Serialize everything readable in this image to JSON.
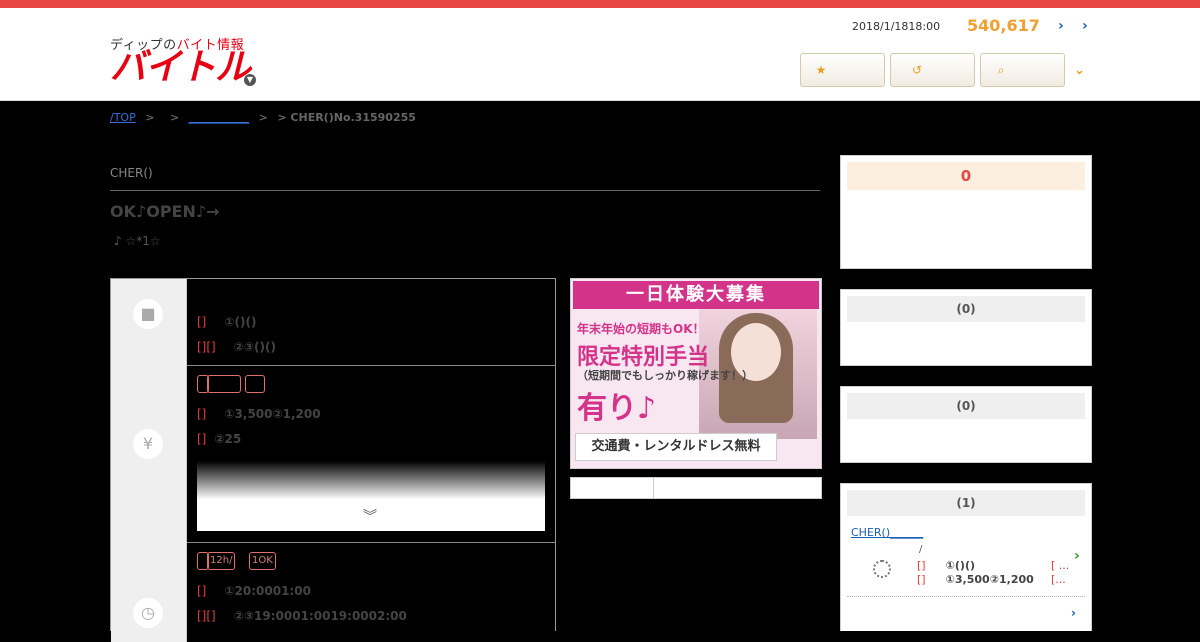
{
  "header": {
    "logo_sub_a": "ディップの",
    "logo_sub_b": "バイト情報",
    "logo_main": "バイトル",
    "date": "2018/1/1818:00",
    "count": "540,617",
    "link1": "›",
    "link2": "›",
    "buttons": [
      {
        "label": "",
        "icon": "star-icon"
      },
      {
        "label": "",
        "icon": "history-icon"
      },
      {
        "label": "",
        "icon": "search-icon"
      }
    ],
    "more": "⌄"
  },
  "breadcrumb": {
    "top": "/TOP",
    "sep": ">",
    "link2": "___________",
    "current": "> CHER()No.31590255"
  },
  "job": {
    "shop": "CHER()",
    "title": "OK♪OPEN♪→",
    "catch": "♪ ☆*1☆"
  },
  "table": {
    "row1": {
      "icon": "briefcase-icon",
      "lines": [
        {
          "tag": "[]",
          "value": "①()()"
        },
        {
          "tag": "[][]",
          "value": "②③()()"
        }
      ]
    },
    "row2": {
      "icon": "yen-icon",
      "badges": [
        "",
        "",
        ""
      ],
      "lines": [
        {
          "tag": "[]",
          "value": "①3,500②1,200"
        },
        {
          "tag": "[]",
          "value": "②25"
        }
      ],
      "expand": "︾"
    },
    "row3": {
      "icon": "clock-icon",
      "badges": [
        "12h/",
        "1OK"
      ],
      "lines": [
        {
          "tag": "[]",
          "value": "①20:0001:00"
        },
        {
          "tag": "[][]",
          "value": "②③19:0001:0019:0002:00"
        }
      ]
    }
  },
  "banner": {
    "top": "一日体験大募集",
    "l1": "年末年始の短期もOK！",
    "l2": "限定特別手当",
    "l3": "（短期間でもしっかり稼げます！）",
    "l4": "有り♪",
    "bottom": "交通費・レンタルドレス無料"
  },
  "sidebar": {
    "card1_head": "0",
    "card2_head": "(0)",
    "card3_head": "(0)",
    "card4_head": "(1)",
    "fav": {
      "link": "CHER()______",
      "slash": "/",
      "line1_tag": "[]",
      "line1_val": "①()()",
      "line1_right": "[ ...",
      "line2_tag": "[]",
      "line2_val": "①3,500②1,200",
      "line2_right": "[...",
      "more": "›"
    }
  }
}
